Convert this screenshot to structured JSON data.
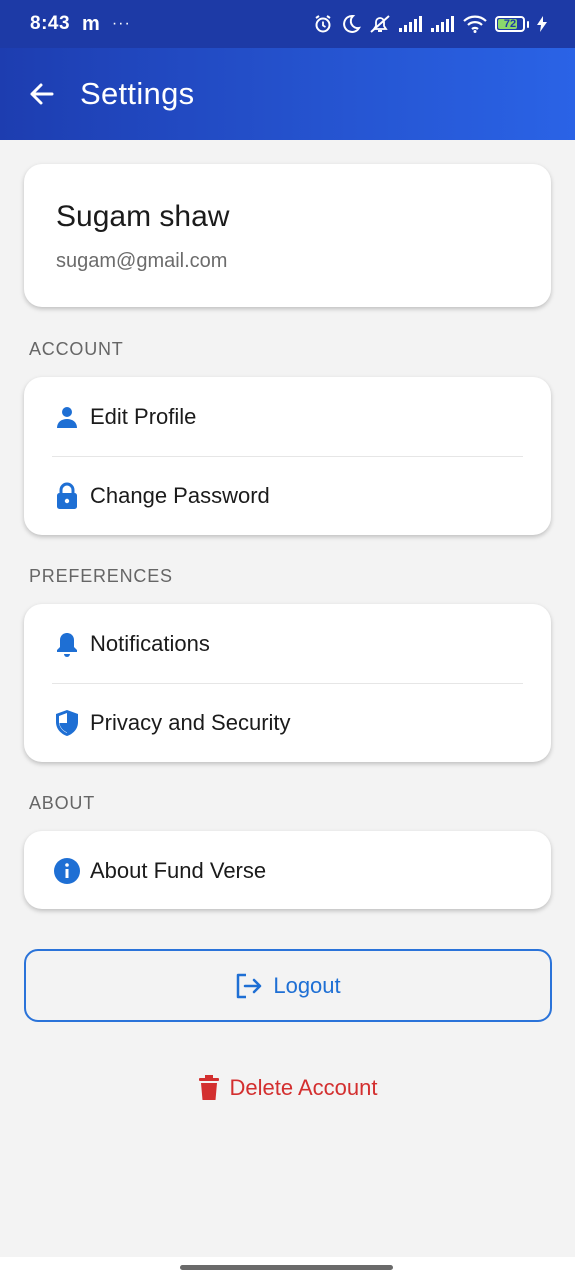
{
  "status_bar": {
    "time": "8:43",
    "carrier_glyph": "m",
    "more": "···",
    "battery": "72",
    "icons": [
      "alarm-icon",
      "moon-icon",
      "mute-icon",
      "signal-icon",
      "signal-icon",
      "wifi-icon",
      "battery-icon",
      "charging-icon"
    ]
  },
  "app_bar": {
    "title": "Settings",
    "back_icon": "arrow-left-icon"
  },
  "profile": {
    "name": "Sugam shaw",
    "email": "sugam@gmail.com"
  },
  "sections": {
    "account": {
      "label": "ACCOUNT",
      "items": [
        {
          "label": "Edit Profile",
          "icon": "person-icon"
        },
        {
          "label": "Change Password",
          "icon": "lock-icon"
        }
      ]
    },
    "preferences": {
      "label": "PREFERENCES",
      "items": [
        {
          "label": "Notifications",
          "icon": "bell-icon"
        },
        {
          "label": "Privacy and Security",
          "icon": "shield-icon"
        }
      ]
    },
    "about": {
      "label": "ABOUT",
      "items": [
        {
          "label": "About Fund Verse",
          "icon": "info-icon"
        }
      ]
    }
  },
  "actions": {
    "logout": "Logout",
    "delete_account": "Delete Account"
  },
  "colors": {
    "app_bar": "#2553cf",
    "accent": "#1e6fd4",
    "danger": "#d32f2f",
    "background": "#f3f3f3"
  }
}
